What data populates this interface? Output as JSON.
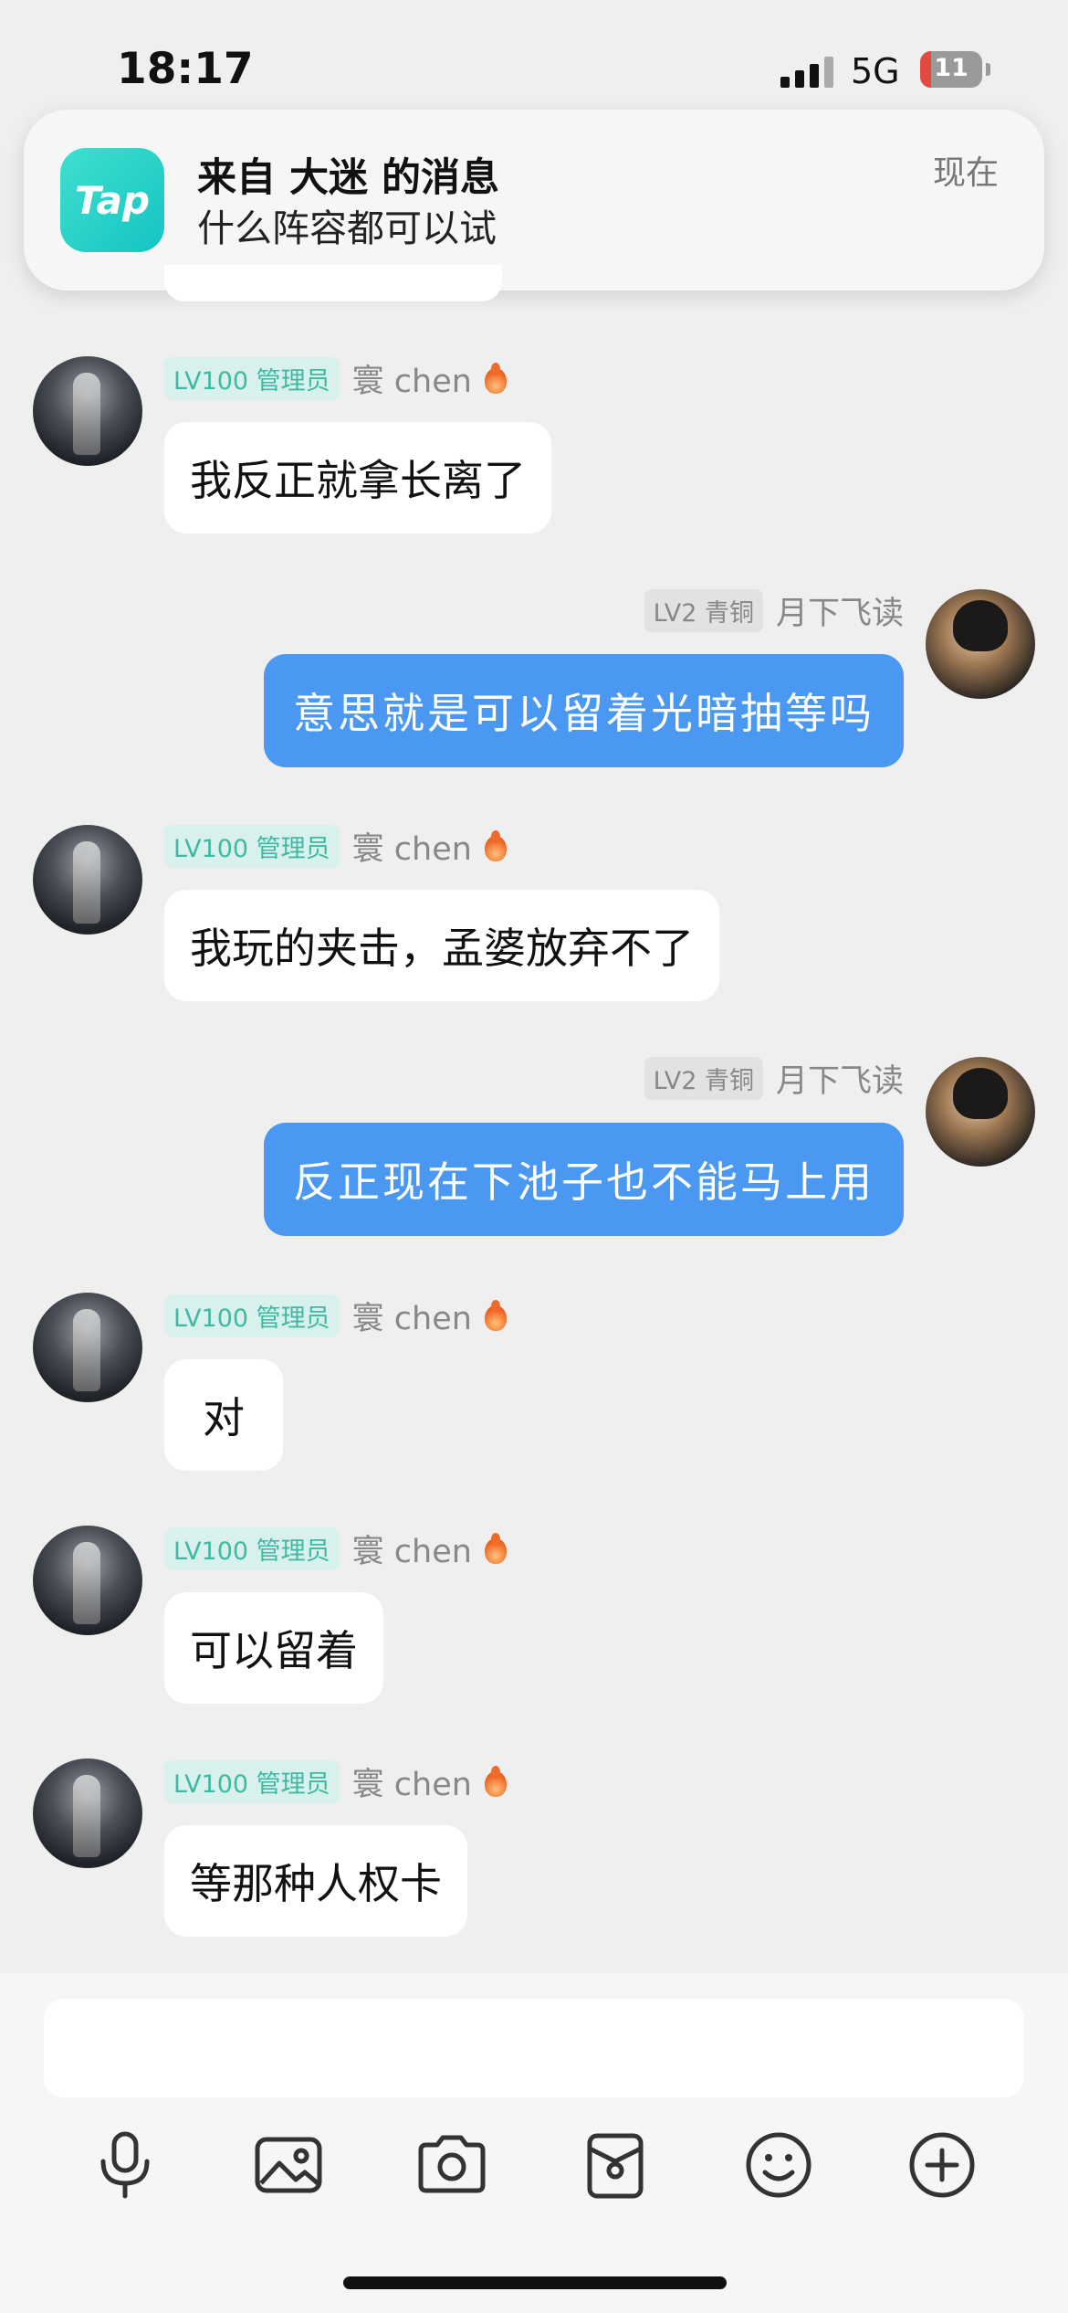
{
  "status_bar": {
    "time": "18:17",
    "network": "5G",
    "battery": "11",
    "battery_level": 0.11
  },
  "notification": {
    "app_icon_text": "Tap",
    "title": "来自 大迷 的消息",
    "body": "什么阵容都可以试",
    "time": "现在"
  },
  "messages": [
    {
      "side": "left",
      "badge": "LV100 管理员",
      "name": "寰 chen",
      "text": "我反正就拿长离了"
    },
    {
      "side": "right",
      "badge": "LV2 青铜",
      "name": "月下飞读",
      "text": "意思就是可以留着光暗抽等吗"
    },
    {
      "side": "left",
      "badge": "LV100 管理员",
      "name": "寰 chen",
      "text": "我玩的夹击，孟婆放弃不了"
    },
    {
      "side": "right",
      "badge": "LV2 青铜",
      "name": "月下飞读",
      "text": "反正现在下池子也不能马上用"
    },
    {
      "side": "left",
      "badge": "LV100 管理员",
      "name": "寰 chen",
      "text": "对"
    },
    {
      "side": "left",
      "badge": "LV100 管理员",
      "name": "寰 chen",
      "text": "可以留着"
    },
    {
      "side": "left",
      "badge": "LV100 管理员",
      "name": "寰 chen",
      "text": "等那种人权卡"
    }
  ],
  "toolbar": {
    "icons": [
      "microphone-icon",
      "image-icon",
      "camera-icon",
      "wallet-icon",
      "emoji-icon",
      "plus-circle-icon"
    ]
  },
  "colors": {
    "accent_blue": "#4a98f1",
    "admin_badge_text": "#3fb8a4",
    "app_icon": "#2fd3c8"
  }
}
